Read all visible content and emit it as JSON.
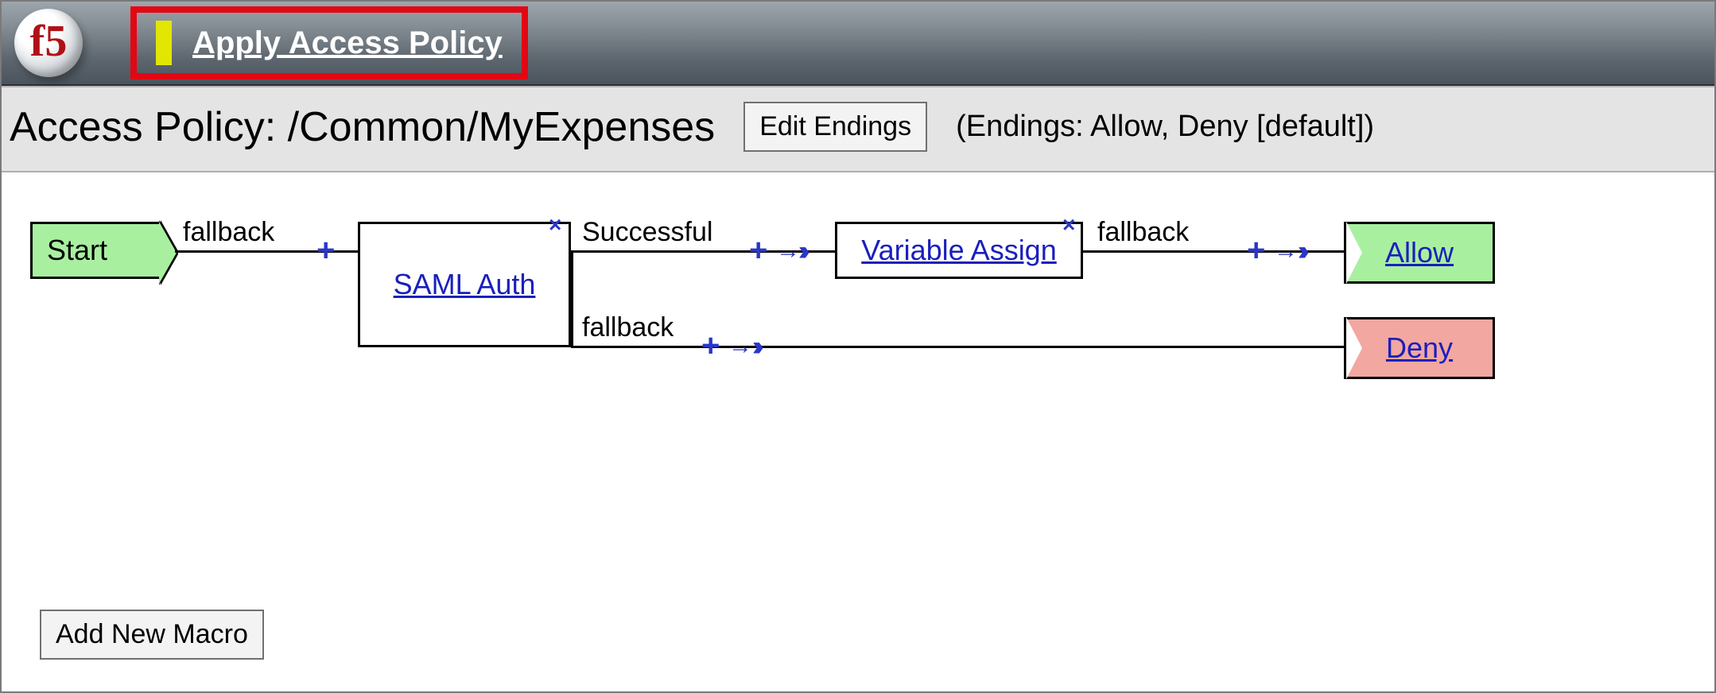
{
  "header": {
    "apply_link": "Apply Access Policy"
  },
  "titlebar": {
    "title": "Access Policy: /Common/MyExpenses",
    "edit_endings": "Edit Endings",
    "endings_info": "(Endings: Allow, Deny [default])"
  },
  "flow": {
    "start": "Start",
    "saml_auth": "SAML Auth",
    "variable_assign": "Variable Assign",
    "allow": "Allow",
    "deny": "Deny",
    "edge_start_fallback": "fallback",
    "edge_saml_success": "Successful",
    "edge_saml_fallback": "fallback",
    "edge_var_fallback": "fallback"
  },
  "buttons": {
    "add_macro": "Add New Macro"
  }
}
